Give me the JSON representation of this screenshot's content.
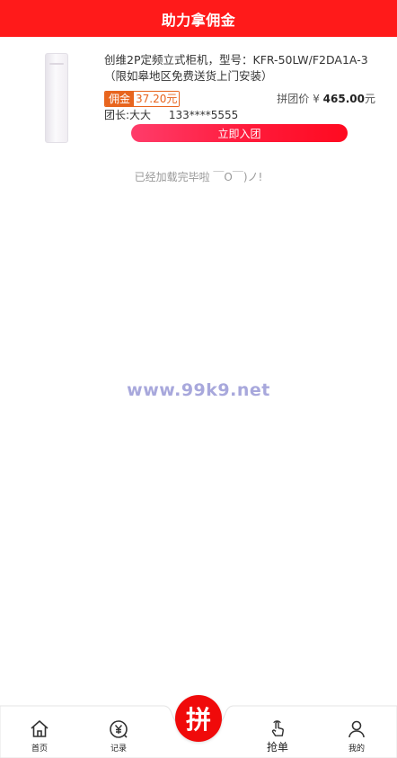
{
  "header": {
    "title": "助力拿佣金"
  },
  "product": {
    "image_icon": "air-conditioner-image",
    "title": "创维2P定频立式柜机，型号：KFR-50LW/F2DA1A-3（限如皋地区免费送货上门安装）",
    "commission_label": "佣金",
    "commission_value": "37.20元",
    "group_price_label": "拼团价",
    "currency": "¥",
    "group_price_amount": "465.00",
    "group_price_unit": "元",
    "leader_label": "团长:大大",
    "leader_phone": "133****5555",
    "join_button": "立即入团"
  },
  "status": {
    "loaded_text": "已经加载完毕啦 ￣O￣)ノ!"
  },
  "watermark": "www.99k9.net",
  "tabbar": {
    "items": [
      {
        "label": "首页",
        "icon": "home-icon"
      },
      {
        "label": "记录",
        "icon": "record-icon"
      },
      {
        "label": "拼",
        "icon": "pin-center-button"
      },
      {
        "label": "抢单",
        "icon": "tap-hand-icon"
      },
      {
        "label": "我的",
        "icon": "user-icon"
      }
    ]
  },
  "colors": {
    "header_bg": "#ff1a1a",
    "commission": "#e8651e",
    "button_gradient_start": "#ff3c6a",
    "button_gradient_end": "#ff0a20",
    "center_button": "#f00a0a"
  }
}
